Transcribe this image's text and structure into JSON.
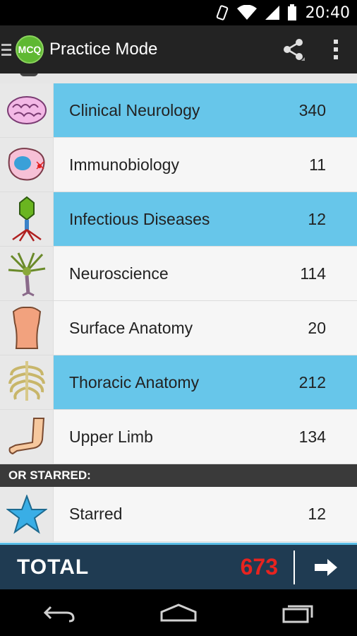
{
  "status_bar": {
    "time": "20:40",
    "icons": [
      "vibrate-icon",
      "wifi-icon",
      "signal-icon",
      "battery-icon"
    ]
  },
  "action_bar": {
    "logo_text": "MCQ",
    "title": "Practice Mode",
    "actions": [
      "share-icon",
      "overflow-menu-icon"
    ]
  },
  "categories": [
    {
      "label": "Clinical Neurology",
      "count": "340",
      "selected": true,
      "icon": "brain-icon"
    },
    {
      "label": "Immunobiology",
      "count": "11",
      "selected": false,
      "icon": "cell-icon"
    },
    {
      "label": "Infectious Diseases",
      "count": "12",
      "selected": true,
      "icon": "virus-icon"
    },
    {
      "label": "Neuroscience",
      "count": "114",
      "selected": false,
      "icon": "neuron-icon"
    },
    {
      "label": "Surface Anatomy",
      "count": "20",
      "selected": false,
      "icon": "torso-icon"
    },
    {
      "label": "Thoracic Anatomy",
      "count": "212",
      "selected": true,
      "icon": "ribcage-icon"
    },
    {
      "label": "Upper Limb",
      "count": "134",
      "selected": false,
      "icon": "arm-icon"
    }
  ],
  "starred_section": {
    "header": "OR STARRED:",
    "label": "Starred",
    "count": "12",
    "icon": "star-icon"
  },
  "total": {
    "label": "TOTAL",
    "value": "673"
  },
  "colors": {
    "selected_row": "#67c6ea",
    "total_bar": "#1f3b52",
    "total_value": "#e8231f",
    "logo": "#5fb832"
  }
}
